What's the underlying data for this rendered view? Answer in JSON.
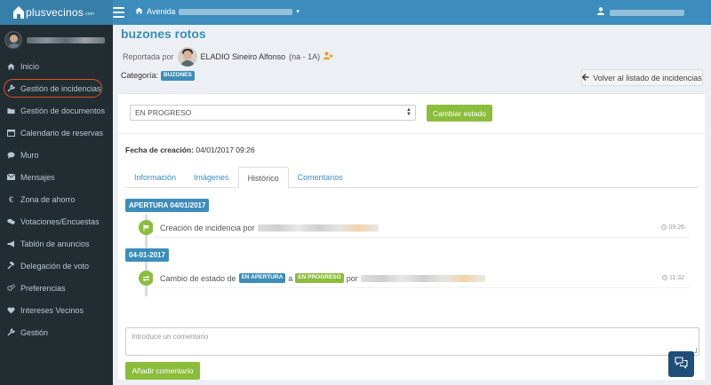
{
  "header": {
    "logo_text": "plusvecinos",
    "logo_small": ".com",
    "breadcrumb_label": "Avenida"
  },
  "sidebar": {
    "items": [
      {
        "label": "Inicio",
        "icon": "home-icon"
      },
      {
        "label": "Gestión de incidencias",
        "icon": "wrench-icon"
      },
      {
        "label": "Gestión de documentos",
        "icon": "folder-icon"
      },
      {
        "label": "Calendario de reservas",
        "icon": "calendar-icon"
      },
      {
        "label": "Muro",
        "icon": "comment-icon"
      },
      {
        "label": "Mensajes",
        "icon": "envelope-icon"
      },
      {
        "label": "Zona de ahorro",
        "icon": "euro-icon"
      },
      {
        "label": "Votaciones/Encuestas",
        "icon": "comments-icon"
      },
      {
        "label": "Tablón de anuncios",
        "icon": "megaphone-icon"
      },
      {
        "label": "Delegación de voto",
        "icon": "gavel-icon"
      },
      {
        "label": "Preferencias",
        "icon": "gears-icon"
      },
      {
        "label": "Intereses Vecinos",
        "icon": "heart-icon"
      },
      {
        "label": "Gestión",
        "icon": "wrench-icon"
      }
    ]
  },
  "page": {
    "title": "buzones rotos",
    "reported_by_label": "Reportada por",
    "reporter_name": "ELADIO Sineiro Alfonso",
    "reporter_meta": "(na - 1A)",
    "category_label": "Categoría:",
    "category_value": "BUZONES",
    "back_button": "Volver al listado de incidencias"
  },
  "status": {
    "selected": "EN PROGRESO",
    "change_button": "Cambiar estado"
  },
  "created": {
    "label": "Fecha de creación:",
    "value": "04/01/2017 09:26"
  },
  "tabs": [
    {
      "label": "Información",
      "active": false
    },
    {
      "label": "Imágenes",
      "active": false
    },
    {
      "label": "Histórico",
      "active": true
    },
    {
      "label": "Comentarios",
      "active": false
    }
  ],
  "timeline": {
    "groups": [
      {
        "label": "APERTURA 04/01/2017",
        "icon": "flag-icon",
        "text": "Creación de incidencia por",
        "time": "09:26"
      },
      {
        "label": "04-01-2017",
        "icon": "exchange-icon",
        "text_prefix": "Cambio de estado de",
        "from_state": "EN APERTURA",
        "connector": "a",
        "to_state": "EN PROGRESO",
        "suffix": "por",
        "time": "11:32"
      }
    ]
  },
  "comment": {
    "placeholder": "Introduce un comentario",
    "button": "Añadir comentario"
  },
  "colors": {
    "brand_blue": "#3c8dbc",
    "accent_green": "#8bbd3b",
    "sidebar_bg": "#222d32"
  }
}
